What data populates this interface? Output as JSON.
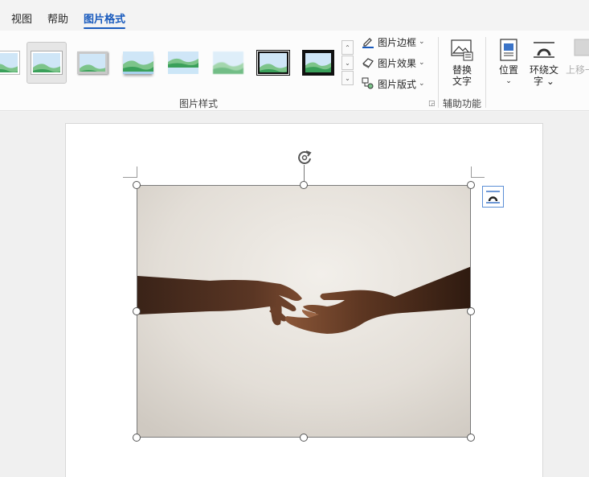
{
  "tabs": [
    {
      "label": "视图",
      "active": false
    },
    {
      "label": "帮助",
      "active": false
    },
    {
      "label": "图片格式",
      "active": true
    }
  ],
  "ribbon": {
    "picture_styles": {
      "group_label": "图片样式",
      "selected_index": 1,
      "styles": [
        "simple-frame",
        "simple-frame-white",
        "beveled-matte",
        "soft-edge",
        "reflected",
        "soft-edge-rectangle",
        "black-frame",
        "thick-black-frame"
      ]
    },
    "commands": {
      "border_label": "图片边框",
      "effects_label": "图片效果",
      "layout_label": "图片版式"
    },
    "accessibility": {
      "group_label": "辅助功能",
      "alt_text_line1": "替换",
      "alt_text_line2": "文字"
    },
    "arrange": {
      "position_label": "位置",
      "wrap_line1": "环绕文",
      "wrap_line2": "字",
      "bring_forward_label": "上移一"
    }
  },
  "colors": {
    "accent": "#185abd",
    "ribbon_bg": "#fcfcfc",
    "tab_bg": "#f3f3f3"
  }
}
